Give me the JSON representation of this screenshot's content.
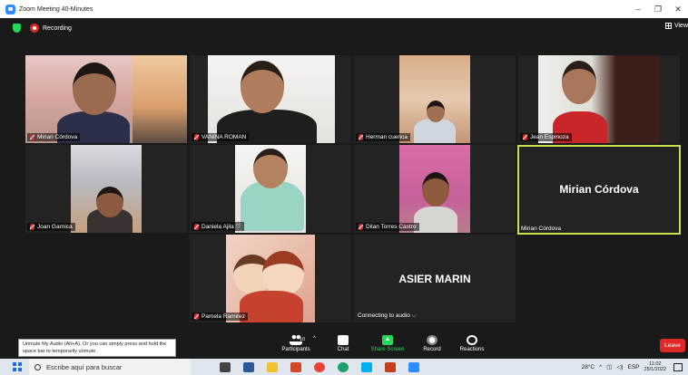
{
  "window": {
    "title": "Zoom Meeting 40-Minutes",
    "minimize": "–",
    "maximize": "❐",
    "close": "✕"
  },
  "meeting": {
    "recording_label": "Recording",
    "view_label": "View"
  },
  "participants": [
    {
      "name": "Mirian Córdova"
    },
    {
      "name": "VANINA ROMAN"
    },
    {
      "name": "Herman cuenca"
    },
    {
      "name": "Jean Espinoza"
    },
    {
      "name": "Joan Garnica"
    },
    {
      "name": "Daniela Ajila"
    },
    {
      "name": "Dilan Torres Castro"
    },
    {
      "name": "Mirian Córdova",
      "display_name": "Mirian Córdova"
    },
    {
      "name": "Pamela Ramirez"
    },
    {
      "display_name": "ASIER MARIN",
      "status": "Connecting to audio"
    }
  ],
  "toolbar": {
    "tooltip": "Unmute My Audio (Alt+A). Or you can simply press and hold the space bar to temporarily unmute.",
    "participants_label": "Participants",
    "participants_count": "10",
    "chat_label": "Chat",
    "share_label": "Share Screen",
    "record_label": "Record",
    "reactions_label": "Reactions",
    "leave_label": "Leave"
  },
  "taskbar": {
    "search_placeholder": "Escribe aquí para buscar",
    "temperature": "28°C",
    "language": "ESP",
    "time": "11:02",
    "date": "25/1/2022"
  },
  "colors": {
    "accent": "#2d8cff",
    "active_speaker": "#c8e04a",
    "leave": "#e02828",
    "share": "#23d959"
  }
}
